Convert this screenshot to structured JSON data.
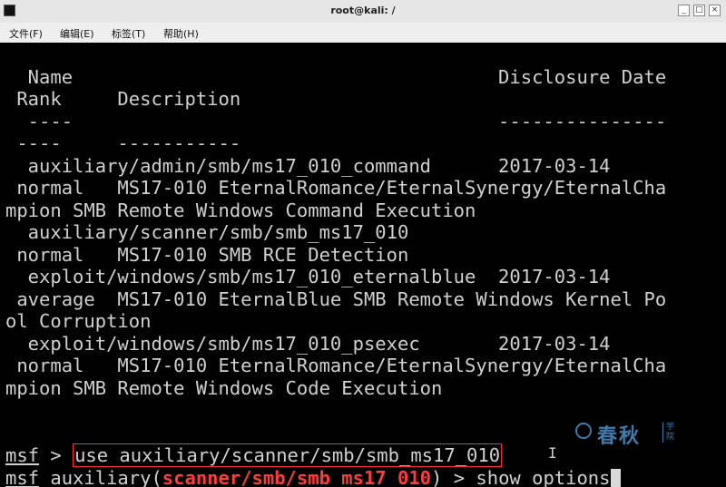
{
  "window": {
    "title": "root@kali: /",
    "controls": {
      "minimize": "_",
      "maximize": "□",
      "close": "×"
    }
  },
  "menu": [
    "文件(F)",
    "编辑(E)",
    "标签(T)",
    "帮助(H)"
  ],
  "terminal": {
    "lines": [
      "  Name                                      Disclosure Date",
      " Rank     Description",
      "  ----                                      ---------------",
      " ----     -----------",
      "  auxiliary/admin/smb/ms17_010_command      2017-03-14",
      " normal   MS17-010 EternalRomance/EternalSynergy/EternalCha",
      "mpion SMB Remote Windows Command Execution",
      "  auxiliary/scanner/smb/smb_ms17_010",
      " normal   MS17-010 SMB RCE Detection",
      "  exploit/windows/smb/ms17_010_eternalblue  2017-03-14",
      " average  MS17-010 EternalBlue SMB Remote Windows Kernel Po",
      "ol Corruption",
      "  exploit/windows/smb/ms17_010_psexec       2017-03-14",
      " normal   MS17-010 EternalRomance/EternalSynergy/EternalCha",
      "mpion SMB Remote Windows Code Execution",
      ""
    ],
    "prompt1": {
      "msf": "msf",
      "sep": " > ",
      "command": "use auxiliary/scanner/smb/smb_ms17_010"
    },
    "prompt2": {
      "msf": "msf",
      "pre": " auxiliary(",
      "module": "scanner/smb/smb_ms17_010",
      "post": ") > ",
      "command": "show options"
    },
    "colors": {
      "text": "#d0d0d0",
      "module": "#ff3b3b",
      "highlight_box": "#ff2d2d",
      "background": "#000000"
    }
  },
  "watermark": {
    "text": "春秋",
    "small": "学院",
    "color": "#4a90c8"
  }
}
